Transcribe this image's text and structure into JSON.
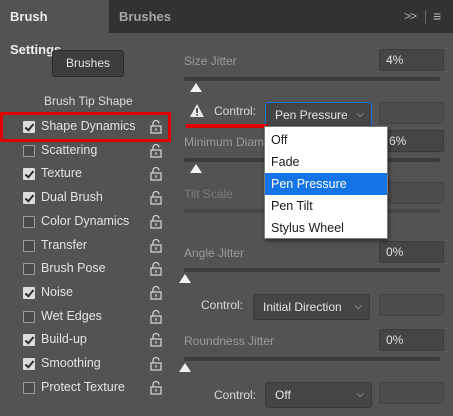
{
  "header": {
    "tab_active": "Brush Settings",
    "tab_inactive": "Brushes",
    "collapse_glyph": ">>",
    "menu_glyph": "≡"
  },
  "left": {
    "brushes_button": "Brushes",
    "tip_shape": "Brush Tip Shape",
    "options": [
      {
        "label": "Shape Dynamics",
        "checked": true
      },
      {
        "label": "Scattering",
        "checked": false
      },
      {
        "label": "Texture",
        "checked": true
      },
      {
        "label": "Dual Brush",
        "checked": true
      },
      {
        "label": "Color Dynamics",
        "checked": false
      },
      {
        "label": "Transfer",
        "checked": false
      },
      {
        "label": "Brush Pose",
        "checked": false
      },
      {
        "label": "Noise",
        "checked": true
      },
      {
        "label": "Wet Edges",
        "checked": false
      },
      {
        "label": "Build-up",
        "checked": true
      },
      {
        "label": "Smoothing",
        "checked": true
      },
      {
        "label": "Protect Texture",
        "checked": false
      }
    ]
  },
  "right": {
    "size_jitter_label": "Size Jitter",
    "size_jitter_value": "4%",
    "control1_label": "Control:",
    "control1_value": "Pen Pressure",
    "min_diameter_label": "Minimum Diam",
    "min_diameter_value": "6%",
    "tilt_scale_label": "Tilt Scale",
    "angle_jitter_label": "Angle Jitter",
    "angle_jitter_value": "0%",
    "control2_label": "Control:",
    "control2_value": "Initial Direction",
    "roundness_jitter_label": "Roundness Jitter",
    "roundness_jitter_value": "0%",
    "control3_label": "Control:",
    "control3_value": "Off"
  },
  "dropdown": {
    "options": [
      "Off",
      "Fade",
      "Pen Pressure",
      "Pen Tilt",
      "Stylus Wheel"
    ],
    "selected": "Pen Pressure"
  },
  "colors": {
    "accent": "#1473e6",
    "highlight": "#e00000"
  }
}
